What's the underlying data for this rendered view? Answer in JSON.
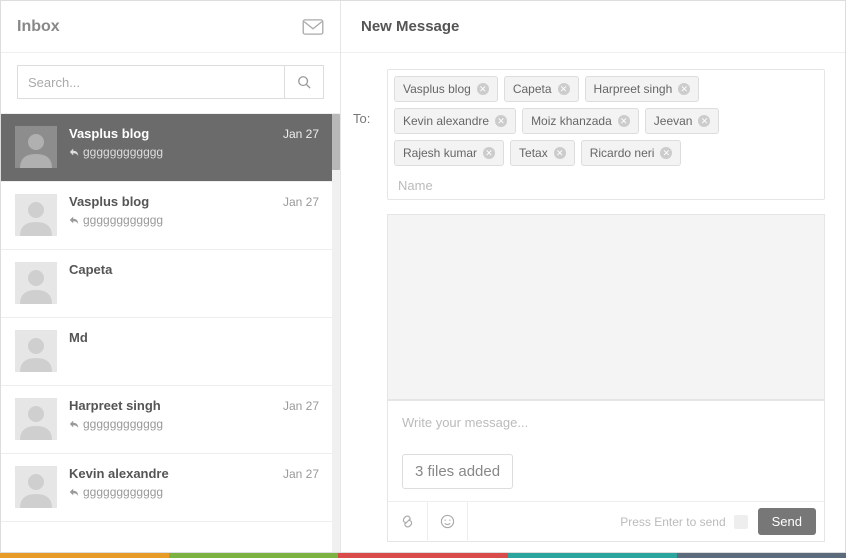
{
  "inbox": {
    "title": "Inbox",
    "search_placeholder": "Search..."
  },
  "conversations": [
    {
      "name": "Vasplus blog",
      "date": "Jan 27",
      "preview": "gggggggggggg",
      "has_reply": true,
      "active": true
    },
    {
      "name": "Vasplus blog",
      "date": "Jan 27",
      "preview": "gggggggggggg",
      "has_reply": true,
      "active": false
    },
    {
      "name": "Capeta",
      "date": "",
      "preview": "",
      "has_reply": false,
      "active": false
    },
    {
      "name": "Md",
      "date": "",
      "preview": "",
      "has_reply": false,
      "active": false
    },
    {
      "name": "Harpreet singh",
      "date": "Jan 27",
      "preview": "gggggggggggg",
      "has_reply": true,
      "active": false
    },
    {
      "name": "Kevin alexandre",
      "date": "Jan 27",
      "preview": "gggggggggggg",
      "has_reply": true,
      "active": false
    }
  ],
  "compose": {
    "title": "New Message",
    "to_label": "To:",
    "recipients": [
      "Vasplus blog",
      "Capeta",
      "Harpreet singh",
      "Kevin alexandre",
      "Moiz khanzada",
      "Jeevan",
      "Rajesh kumar",
      "Tetax",
      "Ricardo neri"
    ],
    "name_placeholder": "Name",
    "message_placeholder": "Write your message...",
    "files_label": "3 files added",
    "hint": "Press Enter to send",
    "send_label": "Send"
  },
  "colorbar": [
    "#e79c28",
    "#7bb241",
    "#d94b4b",
    "#2aa49d",
    "#5b6b7b"
  ]
}
